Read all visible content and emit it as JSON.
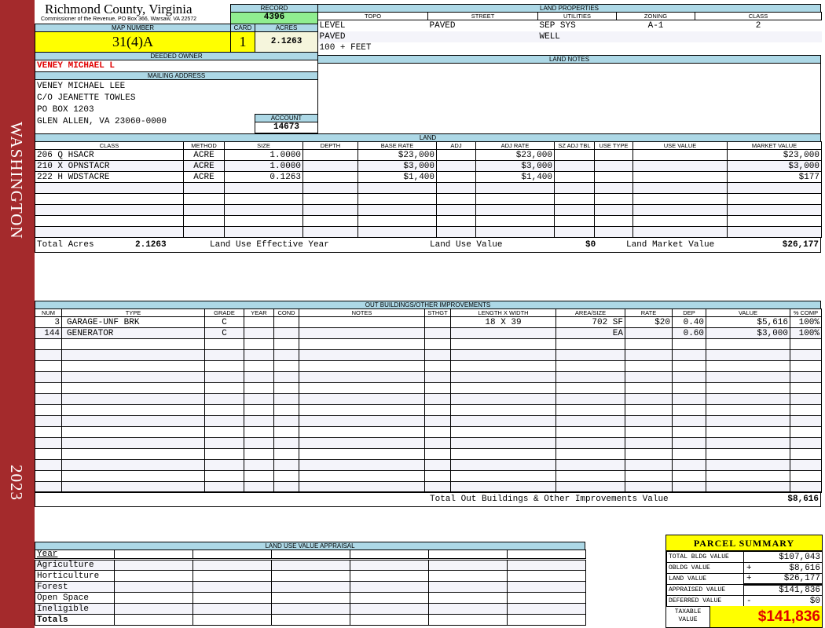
{
  "sidebar": {
    "name": "WASHINGTON",
    "year": "2023",
    "color": "#a42a2c"
  },
  "header": {
    "title": "Richmond County, Virginia",
    "subtitle": "Commissioner of the Revenue, PO Box 366, Warsaw, VA 22572"
  },
  "record": {
    "label": "RECORD",
    "value": "4396"
  },
  "map_number": {
    "label": "MAP NUMBER",
    "value": "31(4)A"
  },
  "card": {
    "label": "CARD",
    "value": "1"
  },
  "acres": {
    "label": "ACRES",
    "value": "2.1263"
  },
  "deeded_owner": {
    "label": "DEEDED OWNER",
    "value": "VENEY MICHAEL L"
  },
  "mailing_address": {
    "label": "MAILING ADDRESS",
    "lines": [
      "VENEY MICHAEL LEE",
      "C/O JEANETTE TOWLES",
      "PO BOX 1203",
      "GLEN ALLEN, VA 23060-0000"
    ]
  },
  "account": {
    "label": "ACCOUNT",
    "value": "14673"
  },
  "land_properties": {
    "label": "LAND PROPERTIES",
    "columns": [
      "TOPO",
      "STREET",
      "UTILITIES",
      "ZONING",
      "CLASS"
    ],
    "rows": [
      [
        "LEVEL",
        "PAVED",
        "SEP SYS",
        "A-1",
        "2"
      ],
      [
        "PAVED",
        "",
        "WELL",
        "",
        ""
      ],
      [
        "100 + FEET",
        "",
        "",
        "",
        ""
      ]
    ]
  },
  "land_notes": {
    "label": "LAND NOTES"
  },
  "land": {
    "label": "LAND",
    "columns": [
      "CLASS",
      "METHOD",
      "SIZE",
      "DEPTH",
      "BASE RATE",
      "ADJ",
      "ADJ RATE",
      "SZ ADJ TBL",
      "USE TYPE",
      "USE VALUE",
      "MARKET VALUE"
    ],
    "rows": [
      [
        "206 Q HSACR",
        "ACRE",
        "1.0000",
        "",
        "$23,000",
        "",
        "$23,000",
        "",
        "",
        "",
        "$23,000"
      ],
      [
        "210 X OPNSTACR",
        "ACRE",
        "1.0000",
        "",
        "$3,000",
        "",
        "$3,000",
        "",
        "",
        "",
        "$3,000"
      ],
      [
        "222 H WDSTACRE",
        "ACRE",
        "0.1263",
        "",
        "$1,400",
        "",
        "$1,400",
        "",
        "",
        "",
        "$177"
      ]
    ],
    "totals": {
      "total_acres_label": "Total Acres",
      "total_acres": "2.1263",
      "effective_year_label": "Land Use Effective Year",
      "use_value_label": "Land Use Value",
      "use_value": "$0",
      "market_value_label": "Land Market Value",
      "market_value": "$26,177"
    }
  },
  "outbuildings": {
    "label": "OUT BUILDINGS/OTHER IMPROVEMENTS",
    "columns": [
      "NUM",
      "TYPE",
      "GRADE",
      "YEAR",
      "COND",
      "NOTES",
      "STHGT",
      "LENGTH X WIDTH",
      "AREA/SIZE",
      "RATE",
      "DEP",
      "VALUE",
      "% COMP"
    ],
    "rows": [
      [
        "3",
        "GARAGE-UNF BRK",
        "C",
        "",
        "",
        "",
        "",
        "18 X 39",
        "702 SF",
        "$20",
        "0.40",
        "$5,616",
        "100%"
      ],
      [
        "144",
        "GENERATOR",
        "C",
        "",
        "",
        "",
        "",
        "",
        "EA",
        "",
        "0.60",
        "$3,000",
        "100%"
      ]
    ],
    "total_label": "Total Out Buildings & Other Improvements Value",
    "total_value": "$8,616"
  },
  "land_use_appraisal": {
    "label": "LAND USE VALUE APPRAISAL",
    "year_label": "Year",
    "rows": [
      "Agriculture",
      "Horticulture",
      "Forest",
      "Open Space",
      "Ineligible"
    ],
    "totals_label": "Totals"
  },
  "parcel_summary": {
    "title": "PARCEL SUMMARY",
    "rows": [
      {
        "label": "TOTAL BLDG VALUE",
        "sign": "",
        "value": "$107,043"
      },
      {
        "label": "OBLDG VALUE",
        "sign": "+",
        "value": "$8,616"
      },
      {
        "label": "LAND VALUE",
        "sign": "+",
        "value": "$26,177"
      },
      {
        "label": "APPRAISED VALUE",
        "sign": "",
        "value": "$141,836"
      },
      {
        "label": "DEFERRED VALUE",
        "sign": "-",
        "value": "$0"
      }
    ],
    "taxable_label": "TAXABLE VALUE",
    "taxable_value": "$141,836"
  }
}
